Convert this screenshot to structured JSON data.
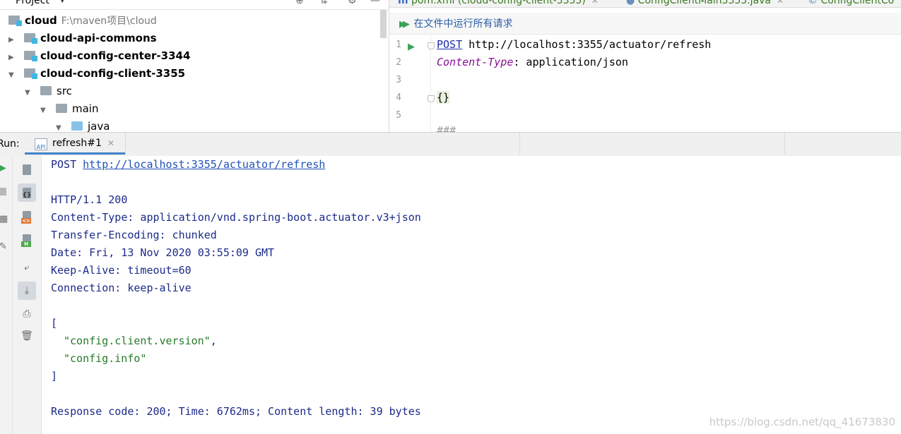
{
  "project": {
    "title": "Project",
    "items": [
      {
        "name": "cloud",
        "path": "F:\\maven项目\\cloud"
      },
      {
        "name": "cloud-api-commons"
      },
      {
        "name": "cloud-config-center-3344"
      },
      {
        "name": "cloud-config-client-3355"
      },
      {
        "name": "src"
      },
      {
        "name": "main"
      },
      {
        "name": "java"
      }
    ]
  },
  "editor": {
    "tabs": [
      {
        "label": "pom.xml (cloud-config-client-3355)"
      },
      {
        "label": "ConfigClientMain3355.java"
      },
      {
        "label": "ConfigClientCo"
      }
    ],
    "run_all_label": "在文件中运行所有请求",
    "line_numbers": [
      "1",
      "2",
      "3",
      "4",
      "5"
    ],
    "lines": {
      "method": "POST",
      "url": " http://localhost:3355/actuator/refresh",
      "header_name": "Content-Type",
      "header_value": ": application/json",
      "body": "{}",
      "separator": "###"
    }
  },
  "run": {
    "label": "Run:",
    "tab_label": "refresh#1",
    "tab_icon_text": "API",
    "output": {
      "method": "POST ",
      "url": "http://localhost:3355/actuator/refresh",
      "status": "HTTP/1.1 200",
      "headers": [
        "Content-Type: application/vnd.spring-boot.actuator.v3+json",
        "Transfer-Encoding: chunked",
        "Date: Fri, 13 Nov 2020 03:55:09 GMT",
        "Keep-Alive: timeout=60",
        "Connection: keep-alive"
      ],
      "open_bracket": "[",
      "values": [
        "\"config.client.version\"",
        "\"config.info\""
      ],
      "comma": ",",
      "close_bracket": "]",
      "summary": "Response code: 200; Time: 6762ms; Content length: 39 bytes"
    }
  },
  "watermark": "https://blog.csdn.net/qq_41673830",
  "colors": {
    "accent": "#4083c9",
    "run_green": "#3aa457",
    "output_text": "#1b2a8a",
    "string": "#277a2a"
  }
}
